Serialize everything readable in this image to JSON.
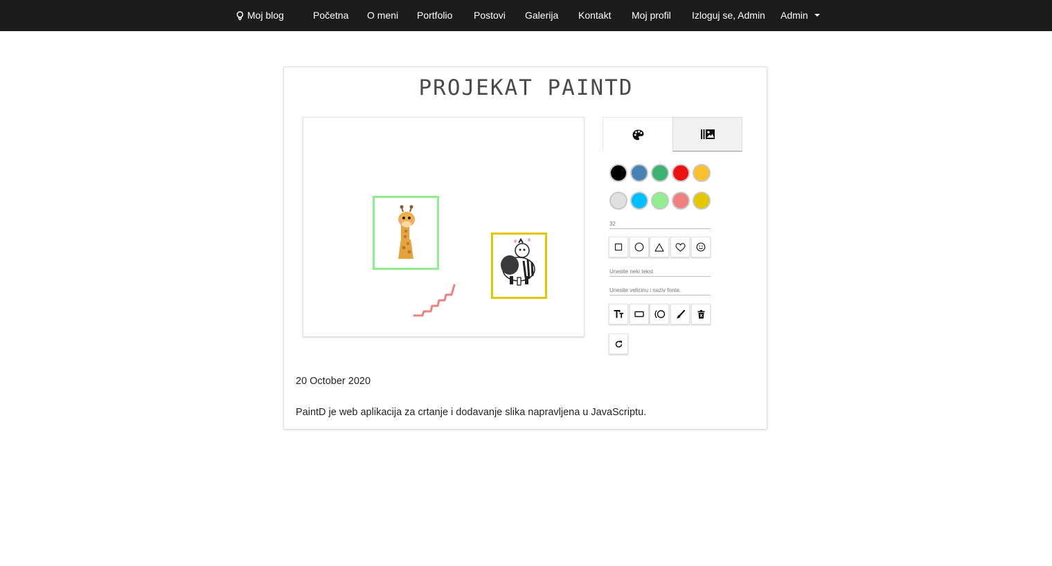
{
  "nav": {
    "brand": "Moj blog",
    "items": [
      "Početna",
      "O meni",
      "Portfolio",
      "Postovi",
      "Galerija",
      "Kontakt",
      "Moj profil",
      "Izloguj se, Admin",
      "Admin"
    ]
  },
  "post": {
    "title": "PROJEKAT PAINTD",
    "date": "20 October 2020",
    "description": "PaintD je web aplikacija za crtanje i dodavanje slika napravljena u JavaScriptu."
  },
  "tabs": [
    {
      "icon": "palette-icon"
    },
    {
      "icon": "image-library-icon"
    }
  ],
  "palette": {
    "row1": [
      "#000000",
      "#4682B4",
      "#3CB371",
      "#EE1111",
      "#FBC02D"
    ],
    "row2": [
      "#E0E0E0",
      "#00BFFF",
      "#90EE90",
      "#F08080",
      "#E5C700"
    ]
  },
  "size_input": {
    "placeholder": "32"
  },
  "text_input": {
    "placeholder": "Unesite neki tekst"
  },
  "font_input": {
    "placeholder": "Unesite velicinu i naziv fonta"
  },
  "shape_tools": [
    "square-icon",
    "circle-icon",
    "triangle-icon",
    "heart-icon",
    "smiley-icon"
  ],
  "action_tools": [
    "text-height-icon",
    "rectangle-icon",
    "ellipse-icon",
    "brush-icon",
    "trash-icon"
  ],
  "reset_tool": "redo-icon",
  "canvas": {
    "frames": [
      {
        "color": "#90EE90",
        "content": "giraffe"
      },
      {
        "color": "#E5C700",
        "content": "zebra"
      }
    ],
    "stroke_color": "#F08080"
  }
}
